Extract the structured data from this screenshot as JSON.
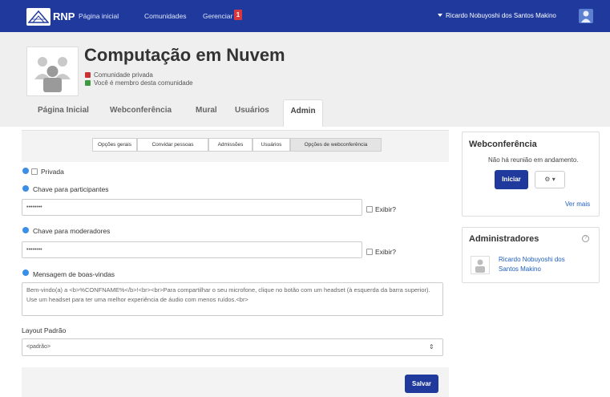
{
  "nav": {
    "logo_text": "RNP",
    "links": [
      "Página inicial",
      "Comunidades",
      "Gerenciar"
    ],
    "badge_count": "1",
    "user_name": "Ricardo Nobuyoshi dos Santos Makino"
  },
  "community": {
    "title": "Computação em Nuvem",
    "privacy": "Comunidade privada",
    "membership": "Você é membro desta comunidade",
    "tabs": [
      "Página Inicial",
      "Webconferência",
      "Mural",
      "Usuários",
      "Admin"
    ]
  },
  "subtabs": [
    "Opções gerais",
    "Convidar pessoas",
    "Admissões",
    "Usuários",
    "Opções de webconferência"
  ],
  "form": {
    "private_label": "Privada",
    "participants_key_label": "Chave para participantes",
    "participants_key_value": "••••••••",
    "moderators_key_label": "Chave para moderadores",
    "moderators_key_value": "••••••••",
    "show_label": "Exibir?",
    "welcome_label": "Mensagem de boas-vindas",
    "welcome_value": "Bem-vindo(a) a <b>%CONFNAME%</b>!<br><br>Para compartilhar o seu microfone, clique no botão com um headset (à esquerda da barra superior). Use um headset para ter uma melhor experiência de áudio com menos ruídos.<br>",
    "layout_label": "Layout Padrão",
    "layout_value": "<padrão>",
    "save_label": "Salvar"
  },
  "webconf_panel": {
    "title": "Webconferência",
    "status": "Não há reunião em andamento.",
    "start_label": "Iniciar",
    "more_label": "Ver mais"
  },
  "admins_panel": {
    "title": "Administradores",
    "admin_name_line1": "Ricardo Nobuyoshi dos",
    "admin_name_line2": "Santos Makino"
  },
  "colors": {
    "brand": "#1f3a9c",
    "badge": "#d9363e",
    "link": "#1f5fbf",
    "info": "#3a8ee6"
  }
}
